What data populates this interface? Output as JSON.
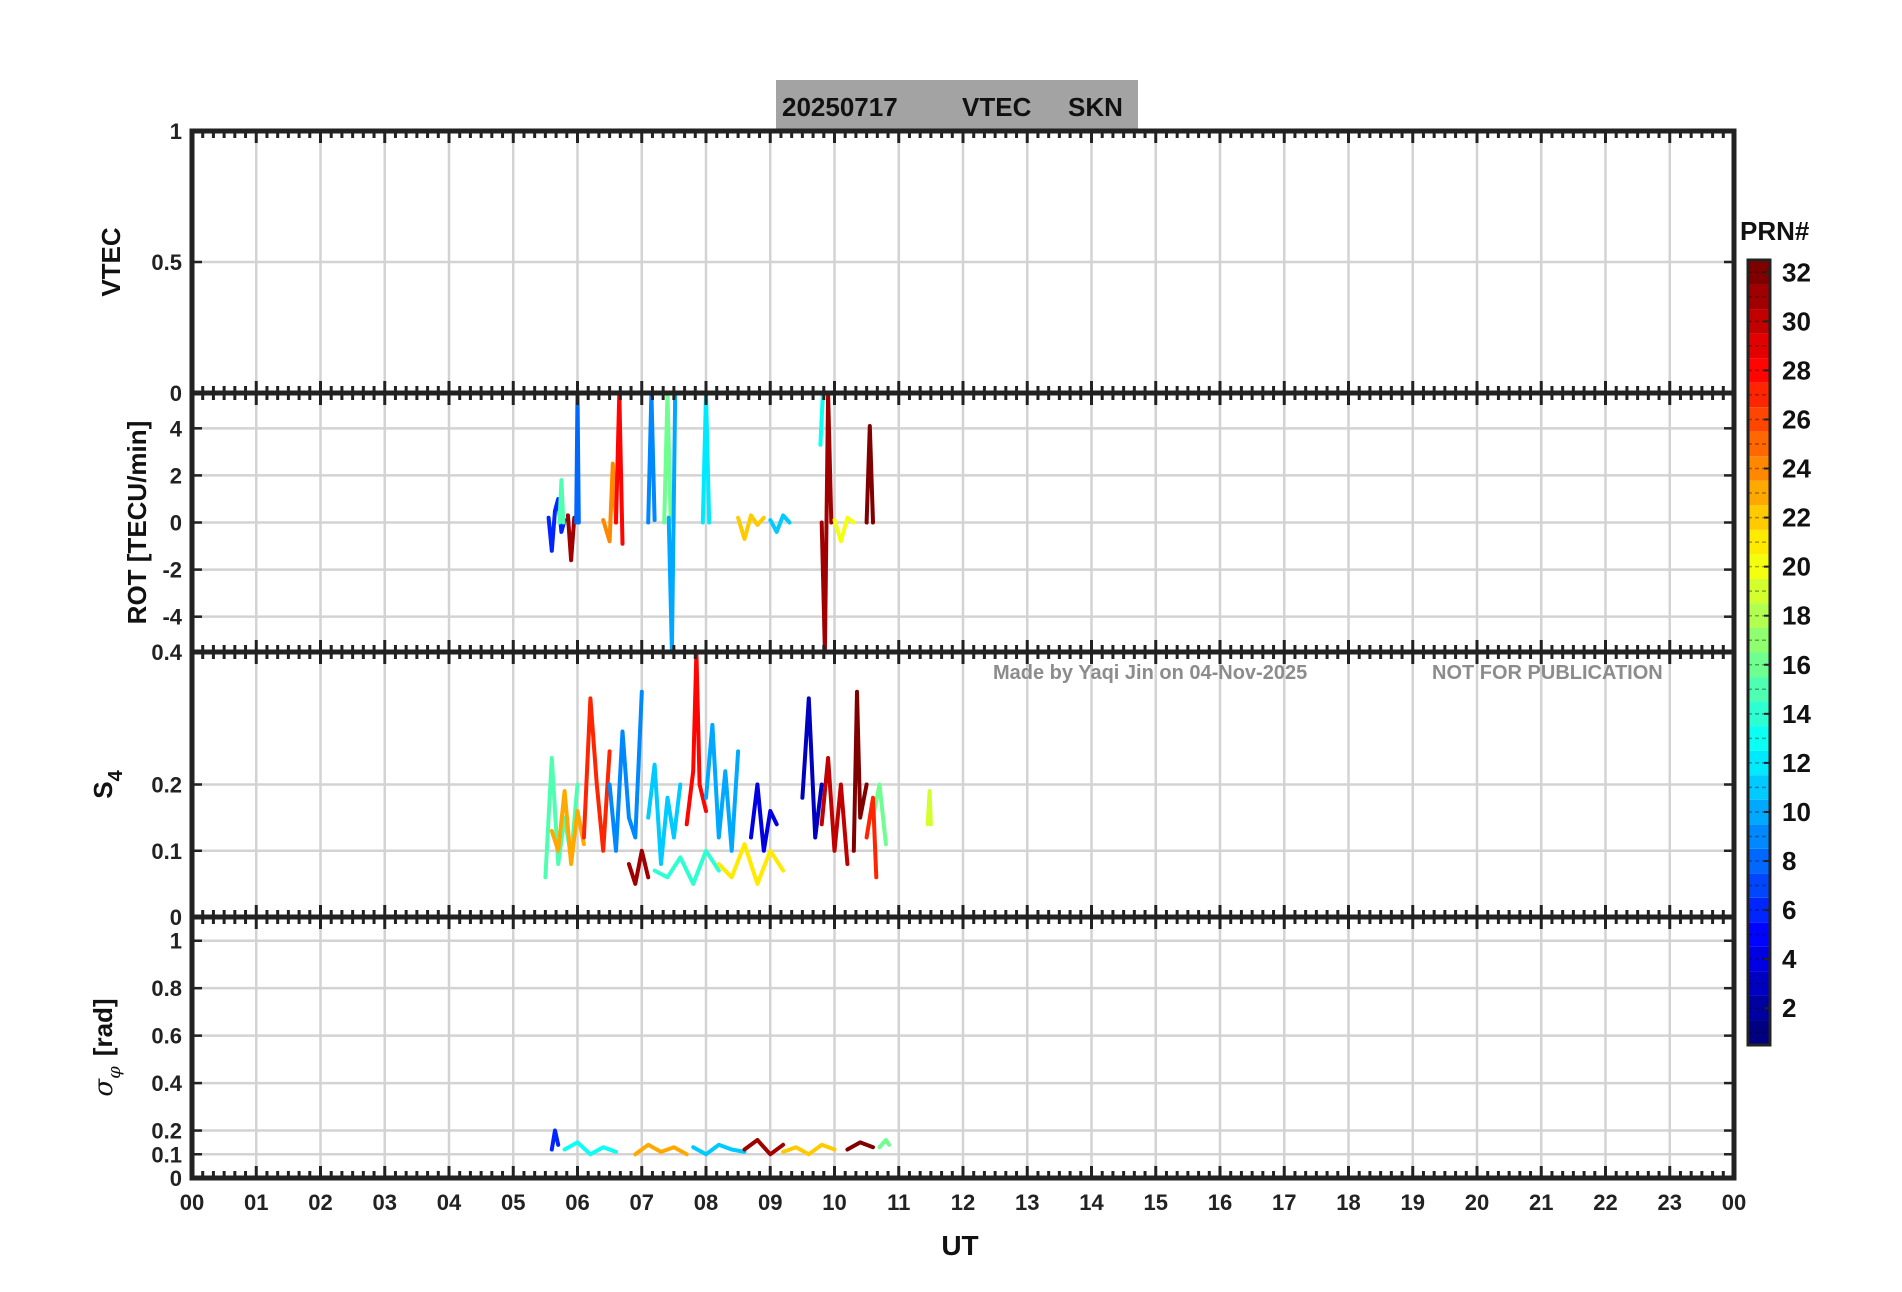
{
  "header": {
    "date": "20250717",
    "quantity": "VTEC",
    "station": "SKN"
  },
  "watermark": {
    "made_by": "Made by Yaqi Jin on 04-Nov-2025",
    "notice": "NOT FOR PUBLICATION"
  },
  "xaxis": {
    "label": "UT",
    "ticks": [
      "00",
      "01",
      "02",
      "03",
      "04",
      "05",
      "06",
      "07",
      "08",
      "09",
      "10",
      "11",
      "12",
      "13",
      "14",
      "15",
      "16",
      "17",
      "18",
      "19",
      "20",
      "21",
      "22",
      "23",
      "00"
    ],
    "range_hours": [
      0,
      24
    ]
  },
  "colorbar": {
    "label": "PRN#",
    "range": [
      1,
      32
    ],
    "ticks": [
      "2",
      "4",
      "6",
      "8",
      "10",
      "12",
      "14",
      "16",
      "18",
      "20",
      "22",
      "24",
      "26",
      "28",
      "30",
      "32"
    ]
  },
  "panels": [
    {
      "id": "vtec",
      "ylabel": "VTEC",
      "ylim": [
        0,
        1
      ],
      "ticks": [
        {
          "v": 0,
          "t": "0"
        },
        {
          "v": 0.5,
          "t": "0.5"
        },
        {
          "v": 1,
          "t": "1"
        }
      ]
    },
    {
      "id": "rot",
      "ylabel": "ROT [TECU/min]",
      "ylim": [
        -5.5,
        5.5
      ],
      "ticks": [
        {
          "v": -4,
          "t": "-4"
        },
        {
          "v": -2,
          "t": "-2"
        },
        {
          "v": 0,
          "t": "0"
        },
        {
          "v": 2,
          "t": "2"
        },
        {
          "v": 4,
          "t": "4"
        }
      ]
    },
    {
      "id": "s4",
      "ylabel": "S4",
      "ylim": [
        0,
        0.4
      ],
      "ticks": [
        {
          "v": 0,
          "t": "0"
        },
        {
          "v": 0.1,
          "t": "0.1"
        },
        {
          "v": 0.2,
          "t": "0.2"
        },
        {
          "v": 0.4,
          "t": "0.4"
        }
      ]
    },
    {
      "id": "sigma",
      "ylabel": "σφ [rad]",
      "ylim": [
        0,
        1.1
      ],
      "ticks": [
        {
          "v": 0,
          "t": "0"
        },
        {
          "v": 0.1,
          "t": "0.1"
        },
        {
          "v": 0.2,
          "t": "0.2"
        },
        {
          "v": 0.4,
          "t": "0.4"
        },
        {
          "v": 0.6,
          "t": "0.6"
        },
        {
          "v": 0.8,
          "t": "0.8"
        },
        {
          "v": 1,
          "t": "1"
        }
      ]
    }
  ],
  "chart_data": {
    "type": "line",
    "title": "20250717    VTEC  SKN",
    "xlabel": "UT",
    "x_unit": "hours UT",
    "grid": true,
    "series": [
      {
        "panel": "rot",
        "prn": 6,
        "x": [
          5.55,
          5.6,
          5.65,
          5.7,
          5.75,
          5.8
        ],
        "y": [
          0.2,
          -1.2,
          0.5,
          1.0,
          -0.4,
          0.1
        ]
      },
      {
        "panel": "rot",
        "prn": 31,
        "x": [
          5.85,
          5.9,
          5.95
        ],
        "y": [
          0.3,
          -1.6,
          0.2
        ]
      },
      {
        "panel": "rot",
        "prn": 8,
        "x": [
          5.98,
          6.0,
          6.02
        ],
        "y": [
          0.0,
          5.5,
          0.0
        ]
      },
      {
        "panel": "rot",
        "prn": 15,
        "x": [
          5.72,
          5.75,
          5.78
        ],
        "y": [
          0.0,
          1.8,
          0.0
        ]
      },
      {
        "panel": "rot",
        "prn": 24,
        "x": [
          6.4,
          6.5,
          6.55,
          6.6
        ],
        "y": [
          0.1,
          -0.8,
          2.5,
          0.0
        ]
      },
      {
        "panel": "rot",
        "prn": 28,
        "x": [
          6.6,
          6.65,
          6.7
        ],
        "y": [
          0.0,
          5.5,
          -0.9
        ]
      },
      {
        "panel": "rot",
        "prn": 9,
        "x": [
          7.1,
          7.15,
          7.2
        ],
        "y": [
          0.0,
          5.5,
          0.1
        ]
      },
      {
        "panel": "rot",
        "prn": 16,
        "x": [
          7.35,
          7.4,
          7.45
        ],
        "y": [
          0.0,
          5.5,
          0.0
        ]
      },
      {
        "panel": "rot",
        "prn": 10,
        "x": [
          7.42,
          7.47,
          7.52
        ],
        "y": [
          0.2,
          -5.5,
          5.5
        ]
      },
      {
        "panel": "rot",
        "prn": 12,
        "x": [
          7.95,
          8.0,
          8.05
        ],
        "y": [
          0.0,
          5.5,
          0.0
        ]
      },
      {
        "panel": "rot",
        "prn": 31,
        "x": [
          9.8,
          9.85,
          9.9,
          9.95
        ],
        "y": [
          0.0,
          -5.5,
          5.5,
          0.0
        ]
      },
      {
        "panel": "rot",
        "prn": 13,
        "x": [
          9.78,
          9.82
        ],
        "y": [
          3.3,
          5.5
        ]
      },
      {
        "panel": "rot",
        "prn": 32,
        "x": [
          10.5,
          10.55,
          10.6
        ],
        "y": [
          0.0,
          4.1,
          0.0
        ]
      },
      {
        "panel": "rot",
        "prn": 22,
        "x": [
          8.5,
          8.6,
          8.7,
          8.8,
          8.9
        ],
        "y": [
          0.2,
          -0.7,
          0.3,
          -0.1,
          0.2
        ]
      },
      {
        "panel": "rot",
        "prn": 11,
        "x": [
          9.0,
          9.1,
          9.2,
          9.3
        ],
        "y": [
          0.1,
          -0.4,
          0.3,
          0.0
        ]
      },
      {
        "panel": "rot",
        "prn": 20,
        "x": [
          10.0,
          10.1,
          10.2,
          10.3
        ],
        "y": [
          0.1,
          -0.8,
          0.2,
          0.0
        ]
      },
      {
        "panel": "s4",
        "prn": 15,
        "x": [
          5.5,
          5.6,
          5.7,
          5.8,
          5.9,
          6.0
        ],
        "y": [
          0.06,
          0.24,
          0.08,
          0.15,
          0.09,
          0.2
        ]
      },
      {
        "panel": "s4",
        "prn": 23,
        "x": [
          5.6,
          5.7,
          5.8,
          5.9,
          6.0,
          6.1
        ],
        "y": [
          0.13,
          0.1,
          0.19,
          0.08,
          0.16,
          0.11
        ]
      },
      {
        "panel": "s4",
        "prn": 27,
        "x": [
          6.1,
          6.2,
          6.3,
          6.4,
          6.5
        ],
        "y": [
          0.12,
          0.33,
          0.2,
          0.1,
          0.25
        ]
      },
      {
        "panel": "s4",
        "prn": 9,
        "x": [
          6.5,
          6.6,
          6.7,
          6.8,
          6.9,
          7.0
        ],
        "y": [
          0.2,
          0.1,
          0.28,
          0.15,
          0.12,
          0.34
        ]
      },
      {
        "panel": "s4",
        "prn": 31,
        "x": [
          6.8,
          6.9,
          7.0,
          7.1
        ],
        "y": [
          0.08,
          0.05,
          0.1,
          0.06
        ]
      },
      {
        "panel": "s4",
        "prn": 11,
        "x": [
          7.1,
          7.2,
          7.3,
          7.4,
          7.5,
          7.6
        ],
        "y": [
          0.15,
          0.23,
          0.08,
          0.18,
          0.12,
          0.2
        ]
      },
      {
        "panel": "s4",
        "prn": 28,
        "x": [
          7.7,
          7.8,
          7.85,
          7.9,
          8.0
        ],
        "y": [
          0.14,
          0.22,
          0.4,
          0.2,
          0.16
        ]
      },
      {
        "panel": "s4",
        "prn": 14,
        "x": [
          7.2,
          7.4,
          7.6,
          7.8,
          8.0,
          8.2
        ],
        "y": [
          0.07,
          0.06,
          0.09,
          0.05,
          0.1,
          0.07
        ]
      },
      {
        "panel": "s4",
        "prn": 10,
        "x": [
          8.0,
          8.1,
          8.2,
          8.3,
          8.4,
          8.5
        ],
        "y": [
          0.18,
          0.29,
          0.12,
          0.22,
          0.1,
          0.25
        ]
      },
      {
        "panel": "s4",
        "prn": 21,
        "x": [
          8.2,
          8.4,
          8.6,
          8.8,
          9.0,
          9.2
        ],
        "y": [
          0.08,
          0.06,
          0.11,
          0.05,
          0.1,
          0.07
        ]
      },
      {
        "panel": "s4",
        "prn": 4,
        "x": [
          8.7,
          8.8,
          8.9,
          9.0,
          9.1
        ],
        "y": [
          0.12,
          0.2,
          0.1,
          0.16,
          0.14
        ]
      },
      {
        "panel": "s4",
        "prn": 3,
        "x": [
          9.5,
          9.6,
          9.7,
          9.8
        ],
        "y": [
          0.18,
          0.33,
          0.12,
          0.2
        ]
      },
      {
        "panel": "s4",
        "prn": 30,
        "x": [
          9.8,
          9.9,
          10.0,
          10.1,
          10.2
        ],
        "y": [
          0.14,
          0.24,
          0.1,
          0.2,
          0.08
        ]
      },
      {
        "panel": "s4",
        "prn": 32,
        "x": [
          10.3,
          10.35,
          10.4,
          10.5
        ],
        "y": [
          0.1,
          0.34,
          0.15,
          0.2
        ]
      },
      {
        "panel": "s4",
        "prn": 16,
        "x": [
          10.6,
          10.7,
          10.8
        ],
        "y": [
          0.15,
          0.2,
          0.11
        ]
      },
      {
        "panel": "s4",
        "prn": 27,
        "x": [
          10.5,
          10.6,
          10.65
        ],
        "y": [
          0.12,
          0.18,
          0.06
        ]
      },
      {
        "panel": "s4",
        "prn": 19,
        "x": [
          11.45,
          11.48,
          11.5
        ],
        "y": [
          0.14,
          0.19,
          0.14
        ]
      },
      {
        "panel": "sigma",
        "prn": 6,
        "x": [
          5.6,
          5.65,
          5.7
        ],
        "y": [
          0.12,
          0.2,
          0.14
        ]
      },
      {
        "panel": "sigma",
        "prn": 13,
        "x": [
          5.8,
          6.0,
          6.2,
          6.4,
          6.6
        ],
        "y": [
          0.12,
          0.15,
          0.1,
          0.13,
          0.11
        ]
      },
      {
        "panel": "sigma",
        "prn": 23,
        "x": [
          6.9,
          7.1,
          7.3,
          7.5,
          7.7
        ],
        "y": [
          0.1,
          0.14,
          0.11,
          0.13,
          0.1
        ]
      },
      {
        "panel": "sigma",
        "prn": 11,
        "x": [
          7.8,
          8.0,
          8.2,
          8.4,
          8.6
        ],
        "y": [
          0.13,
          0.1,
          0.14,
          0.12,
          0.11
        ]
      },
      {
        "panel": "sigma",
        "prn": 31,
        "x": [
          8.6,
          8.8,
          9.0,
          9.2
        ],
        "y": [
          0.12,
          0.16,
          0.1,
          0.14
        ]
      },
      {
        "panel": "sigma",
        "prn": 22,
        "x": [
          9.2,
          9.4,
          9.6,
          9.8,
          10.0
        ],
        "y": [
          0.11,
          0.13,
          0.1,
          0.14,
          0.12
        ]
      },
      {
        "panel": "sigma",
        "prn": 32,
        "x": [
          10.2,
          10.4,
          10.6
        ],
        "y": [
          0.12,
          0.15,
          0.13
        ]
      },
      {
        "panel": "sigma",
        "prn": 16,
        "x": [
          10.7,
          10.8,
          10.85
        ],
        "y": [
          0.13,
          0.16,
          0.14
        ]
      }
    ]
  }
}
